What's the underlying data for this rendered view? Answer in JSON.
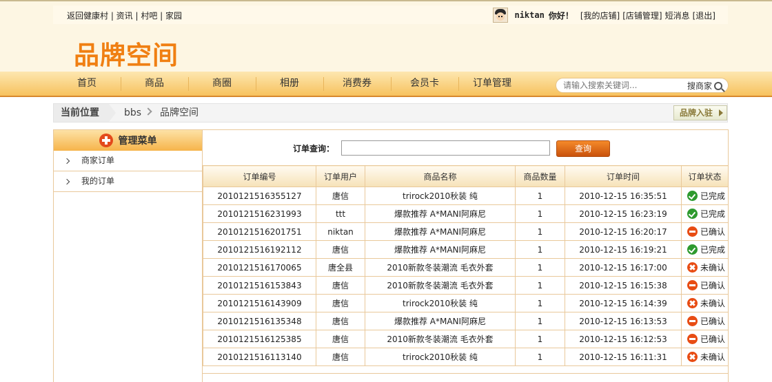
{
  "top": {
    "links": "返回健康村 | 资讯 | 村吧 | 家园",
    "username": "niktan",
    "greeting": "你好！",
    "user_links": [
      "[我的店铺]",
      "[店铺管理]",
      "短消息",
      "[退出]"
    ]
  },
  "logo": "品牌空间",
  "nav": {
    "items": [
      "首页",
      "商品",
      "商圈",
      "相册",
      "消费券",
      "会员卡",
      "订单管理"
    ],
    "search_placeholder": "请输入搜索关键词...",
    "search_button": "搜商家"
  },
  "breadcrumb": {
    "current_label": "当前位置",
    "path": [
      "bbs",
      "品牌空间"
    ],
    "brand_button": "品牌入驻"
  },
  "sidebar": {
    "title": "管理菜单",
    "items": [
      "商家订单",
      "我的订单"
    ]
  },
  "query": {
    "label": "订单查询：",
    "value": "",
    "button": "查询"
  },
  "table": {
    "headers": [
      "订单编号",
      "订单用户",
      "商品名称",
      "商品数量",
      "订单时间",
      "订单状态"
    ],
    "rows": [
      {
        "id": "2010121516355127",
        "user": "唐信",
        "product": "trirock2010秋装 纯",
        "qty": "1",
        "time": "2010-12-15 16:35:51",
        "status": "已完成",
        "status_icon": "check-icon"
      },
      {
        "id": "2010121516231993",
        "user": "ttt",
        "product": "爆款推荐 A*MANI阿麻尼",
        "qty": "1",
        "time": "2010-12-15 16:23:19",
        "status": "已完成",
        "status_icon": "check-icon"
      },
      {
        "id": "2010121516201751",
        "user": "niktan",
        "product": "爆款推荐 A*MANI阿麻尼",
        "qty": "1",
        "time": "2010-12-15 16:20:17",
        "status": "已确认",
        "status_icon": "minus-icon"
      },
      {
        "id": "2010121516192112",
        "user": "唐信",
        "product": "爆款推荐 A*MANI阿麻尼",
        "qty": "1",
        "time": "2010-12-15 16:19:21",
        "status": "已完成",
        "status_icon": "check-icon"
      },
      {
        "id": "2010121516170065",
        "user": "唐全县",
        "product": "2010新款冬装潮流 毛衣外套",
        "qty": "1",
        "time": "2010-12-15 16:17:00",
        "status": "未确认",
        "status_icon": "cross-icon"
      },
      {
        "id": "2010121516153843",
        "user": "唐信",
        "product": "2010新款冬装潮流 毛衣外套",
        "qty": "1",
        "time": "2010-12-15 16:15:38",
        "status": "已确认",
        "status_icon": "minus-icon"
      },
      {
        "id": "2010121516143909",
        "user": "唐信",
        "product": "trirock2010秋装 纯",
        "qty": "1",
        "time": "2010-12-15 16:14:39",
        "status": "未确认",
        "status_icon": "cross-icon"
      },
      {
        "id": "2010121516135348",
        "user": "唐信",
        "product": "爆款推荐 A*MANI阿麻尼",
        "qty": "1",
        "time": "2010-12-15 16:13:53",
        "status": "已确认",
        "status_icon": "minus-icon"
      },
      {
        "id": "2010121516125385",
        "user": "唐信",
        "product": "2010新款冬装潮流 毛衣外套",
        "qty": "1",
        "time": "2010-12-15 16:12:53",
        "status": "已确认",
        "status_icon": "minus-icon"
      },
      {
        "id": "2010121516113140",
        "user": "唐信",
        "product": "trirock2010秋装 纯",
        "qty": "1",
        "time": "2010-12-15 16:11:31",
        "status": "未确认",
        "status_icon": "cross-icon"
      }
    ]
  },
  "colors": {
    "accent": "#f07f12",
    "nav_border": "#d8882d",
    "table_border": "#e9c89a",
    "status_done": "#2e9a2e",
    "status_alert": "#e84c13"
  }
}
